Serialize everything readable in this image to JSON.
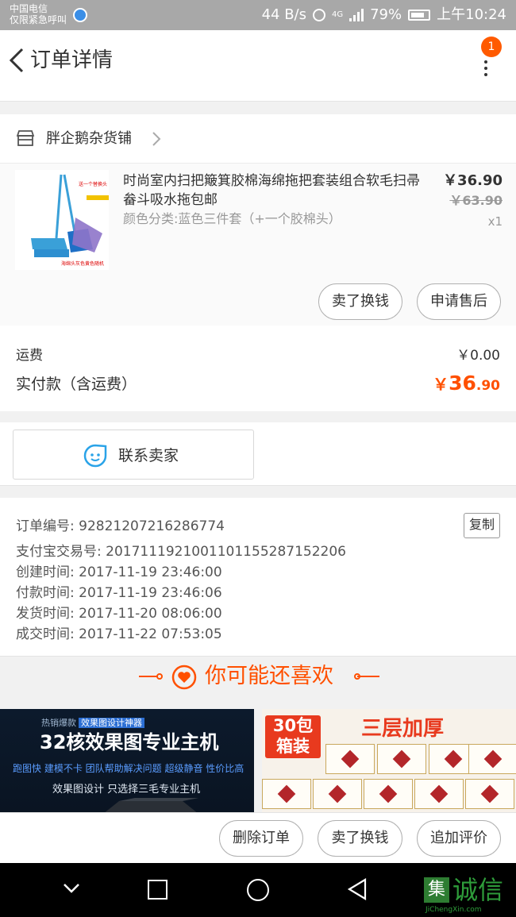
{
  "status_bar": {
    "carrier_line1": "中国电信",
    "carrier_line2": "仅限紧急呼叫",
    "net_speed": "44 B/s",
    "network": "4G",
    "battery": "79%",
    "time": "上午10:24"
  },
  "nav": {
    "title": "订单详情",
    "notification_count": "1"
  },
  "shop": {
    "name": "胖企鹅杂货铺"
  },
  "product": {
    "title": "时尚室内扫把簸箕胶棉海绵拖把套装组合软毛扫帚畚斗吸水拖包邮",
    "sku": "颜色分类:蓝色三件套（+一个胶棉头）",
    "price": "￥36.90",
    "original_price": "￥63.90",
    "quantity": "x1",
    "image_caption_top": "送一个替换头",
    "image_caption_bottom": "海绵头灰色黄色随机",
    "buttons": {
      "sell": "卖了换钱",
      "after_sale": "申请售后"
    }
  },
  "totals": {
    "shipping_label": "运费",
    "shipping_value": "￥0.00",
    "paid_label": "实付款（含运费）",
    "paid_currency": "￥",
    "paid_integer": "36",
    "paid_decimal": ".90"
  },
  "contact": {
    "label": "联系卖家"
  },
  "order_info": {
    "order_no": "订单编号: 92821207216286774",
    "copy_label": "复制",
    "alipay_no": "支付宝交易号: 2017111921001101155287152206",
    "created": "创建时间: 2017-11-19 23:46:00",
    "paid": "付款时间: 2017-11-19 23:46:06",
    "shipped": "发货时间: 2017-11-20 08:06:00",
    "completed": "成交时间: 2017-11-22 07:53:05"
  },
  "recommend": {
    "title": "你可能还喜欢",
    "ad1": {
      "tag": "热销爆款",
      "tag_highlight": "效果图设计神器",
      "title": "32核效果图专业主机",
      "subtitle": "跑图快  建模不卡  团队帮助解决问题  超级静音  性价比高",
      "footer": "效果图设计 只选择三毛专业主机"
    },
    "ad2": {
      "tag": "30包 箱装",
      "title": "三层加厚"
    }
  },
  "actions": {
    "delete": "删除订单",
    "sell": "卖了换钱",
    "review": "追加评价"
  },
  "watermark": {
    "logo_char": "集",
    "text": "诚信",
    "url": "JiChengXin.com"
  },
  "colors": {
    "accent": "#ff5000",
    "badge": "#ff5a00",
    "contact_icon": "#2aa3e8"
  }
}
